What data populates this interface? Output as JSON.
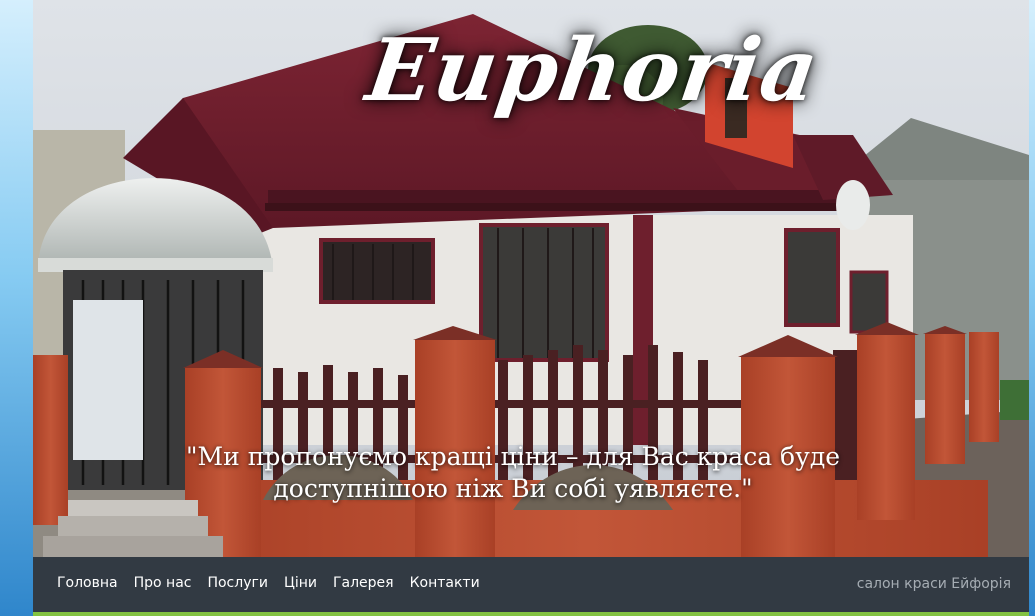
{
  "hero": {
    "logo_text": "Euphoria",
    "quote_line1": "\"Ми пропонуємо кращі ціни – для Вас краса буде",
    "quote_line2": "доступнішою ніж Ви собі уявляєте.\""
  },
  "nav": {
    "items": [
      {
        "label": "Головна"
      },
      {
        "label": "Про нас"
      },
      {
        "label": "Послуги"
      },
      {
        "label": "Ціни"
      },
      {
        "label": "Галерея"
      },
      {
        "label": "Контакти"
      }
    ],
    "brand": "салон краси Ейфорія"
  },
  "colors": {
    "nav_background": "#323a43",
    "nav_accent_line": "#83c341",
    "roof": "#6e1f2d",
    "brick": "#b5482f",
    "page_side_gradient": "#7cc7f1"
  }
}
